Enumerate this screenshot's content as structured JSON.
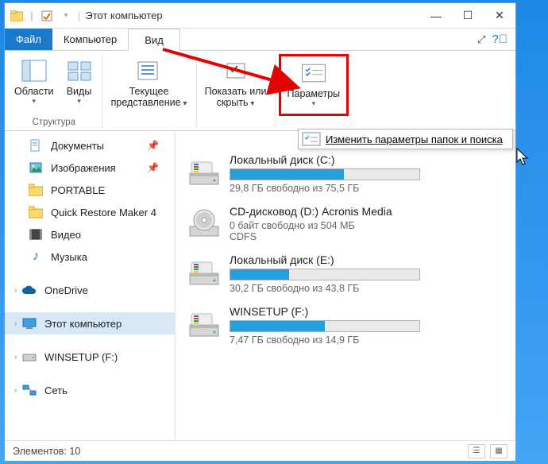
{
  "window": {
    "title": "Этот компьютер"
  },
  "tabs": {
    "file": "Файл",
    "computer": "Компьютер",
    "view": "Вид"
  },
  "ribbon": {
    "panes": "Области",
    "views": "Виды",
    "panes_group": "Структура",
    "current_view": "Текущее представление",
    "show_hide": "Показать или скрыть",
    "options": "Параметры",
    "options_menu": "Изменить параметры папок и поиска"
  },
  "nav": {
    "documents": "Документы",
    "pictures": "Изображения",
    "portable": "PORTABLE",
    "qrm": "Quick Restore Maker 4",
    "video": "Видео",
    "music": "Музыка",
    "onedrive": "OneDrive",
    "thispc": "Этот компьютер",
    "winsetup": "WINSETUP (F:)",
    "network": "Сеть"
  },
  "drives": [
    {
      "name": "Локальный диск (C:)",
      "stat": "29,8 ГБ свободно из 75,5 ГБ",
      "pct": 60,
      "type": "hdd"
    },
    {
      "name": "CD-дисковод (D:) Acronis Media",
      "stat": "0 байт свободно из 504 МБ",
      "sub": "CDFS",
      "type": "cd"
    },
    {
      "name": "Локальный диск (E:)",
      "stat": "30,2 ГБ свободно из 43,8 ГБ",
      "pct": 31,
      "type": "hdd"
    },
    {
      "name": "WINSETUP (F:)",
      "stat": "7,47 ГБ свободно из 14,9 ГБ",
      "pct": 50,
      "type": "hdd"
    }
  ],
  "status": {
    "label": "Элементов:",
    "count": "10"
  }
}
